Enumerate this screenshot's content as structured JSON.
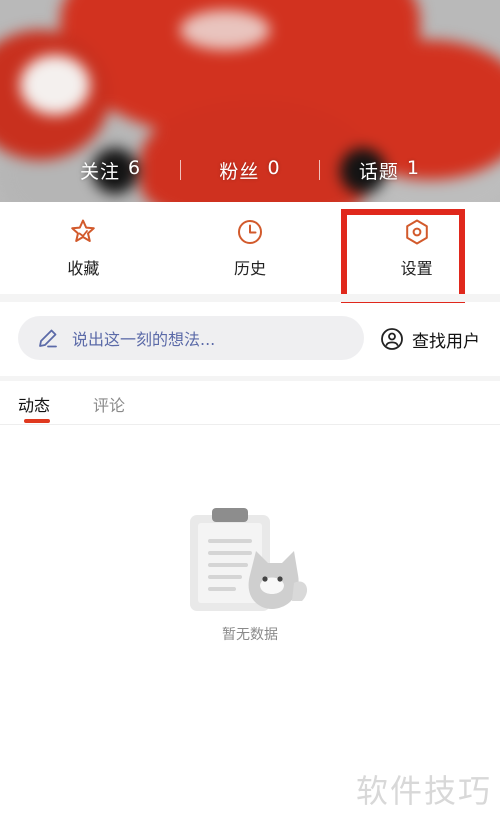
{
  "header": {
    "stats": [
      {
        "label": "关注",
        "value": "6"
      },
      {
        "label": "粉丝",
        "value": "0"
      },
      {
        "label": "话题",
        "value": "1"
      }
    ]
  },
  "actions": [
    {
      "label": "收藏",
      "icon": "star-icon"
    },
    {
      "label": "历史",
      "icon": "clock-icon"
    },
    {
      "label": "设置",
      "icon": "settings-icon",
      "highlighted": true
    }
  ],
  "composer": {
    "placeholder": "说出这一刻的想法..."
  },
  "find_user": {
    "label": "查找用户"
  },
  "tabs": [
    {
      "label": "动态",
      "active": true
    },
    {
      "label": "评论",
      "active": false
    }
  ],
  "empty": {
    "text": "暂无数据"
  },
  "watermark": {
    "text": "软件技巧"
  },
  "colors": {
    "accent": "#e0391f",
    "highlight": "#e0281c",
    "placeholder": "#5b6aa8"
  }
}
